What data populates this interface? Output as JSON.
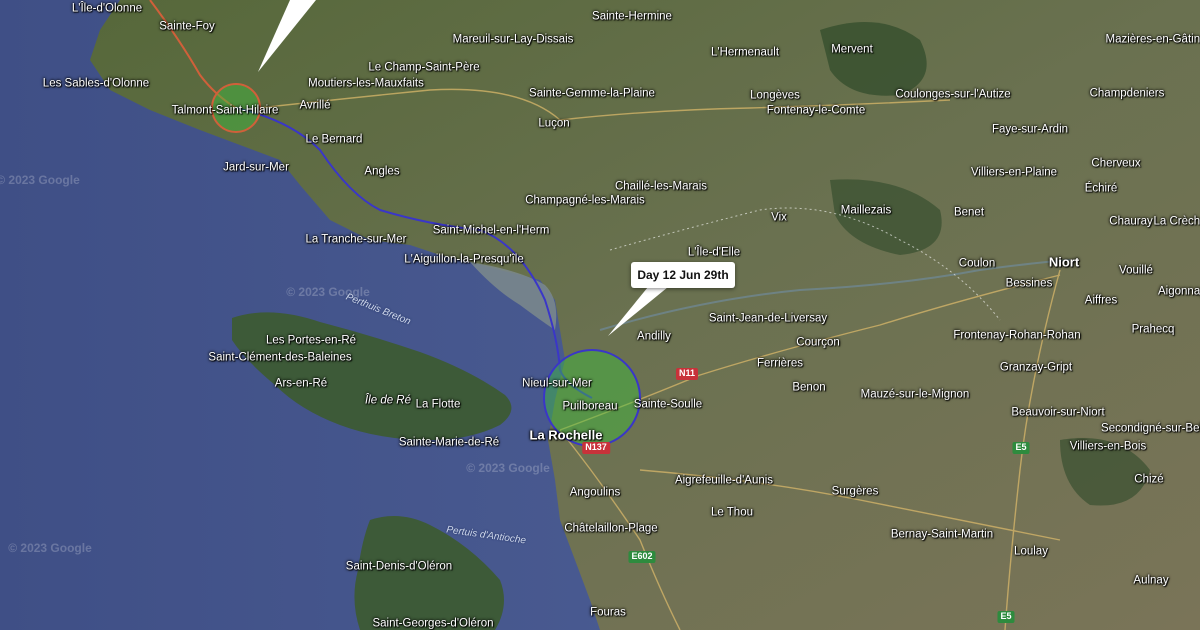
{
  "map": {
    "callout_text": "Day 12 Jun 29th",
    "colors": {
      "route_past": "#d0603a",
      "route_current": "#3a36c8",
      "marker_fill": "#3fbf3f",
      "sea": "#4a5a8c",
      "land": "#5f6f45"
    },
    "watermarks": [
      "© 2023 Google",
      "© 2023 Google",
      "© 2023 Google",
      "© 2023 Google"
    ],
    "road_shields": [
      "N11",
      "N137",
      "E602",
      "E5",
      "E5"
    ],
    "water_labels": [
      "Perthuis Breton",
      "Pertuis d'Antioche"
    ],
    "places": [
      "L'Île-d'Olonne",
      "Sainte-Foy",
      "Les Sables-d'Olonne",
      "Talmont-Saint-Hilaire",
      "Avrillé",
      "Le Champ-Saint-Père",
      "Moutiers-les-Mauxfaits",
      "Mareuil-sur-Lay-Dissais",
      "Sainte-Hermine",
      "L'Hermenault",
      "Mervent",
      "Mazières-en-Gâtine",
      "Sainte-Gemme-la-Plaine",
      "Longèves",
      "Fontenay-le-Comte",
      "Coulonges-sur-l'Autize",
      "Champdeniers",
      "Luçon",
      "Faye-sur-Ardin",
      "Le Bernard",
      "Jard-sur-Mer",
      "Angles",
      "Cherveux",
      "Villiers-en-Plaine",
      "Échiré",
      "Chaillé-les-Marais",
      "Champagné-les-Marais",
      "Maillezais",
      "Benet",
      "Chauray",
      "La Crèche",
      "Vix",
      "Saint-Michel-en-l'Herm",
      "La Tranche-sur-Mer",
      "L'Île-d'Elle",
      "L'Aiguillon-la-Presqu'île",
      "Coulon",
      "Niort",
      "Vouillé",
      "Bessines",
      "Aiffres",
      "Aigonnay",
      "Saint-Jean-de-Liversay",
      "Andilly",
      "Prahecq",
      "Les Portes-en-Ré",
      "Courçon",
      "Frontenay-Rohan-Rohan",
      "Saint-Clément-des-Baleines",
      "Ferrières",
      "Granzay-Gript",
      "Nieul-sur-Mer",
      "Ars-en-Ré",
      "Benon",
      "Mauzé-sur-le-Mignon",
      "Île de Ré",
      "La Flotte",
      "Puilboreau",
      "Sainte-Soulle",
      "Beauvoir-sur-Niort",
      "Secondigné-sur-Belle",
      "La Rochelle",
      "Sainte-Marie-de-Ré",
      "Villiers-en-Bois",
      "Chizé",
      "Aigrefeuille-d'Aunis",
      "Angoulins",
      "Surgères",
      "Le Thou",
      "Châtelaillon-Plage",
      "Bernay-Saint-Martin",
      "Saint-Denis-d'Oléron",
      "Loulay",
      "Aulnay",
      "Fouras",
      "Saint-Georges-d'Oléron",
      "Mervent"
    ]
  }
}
